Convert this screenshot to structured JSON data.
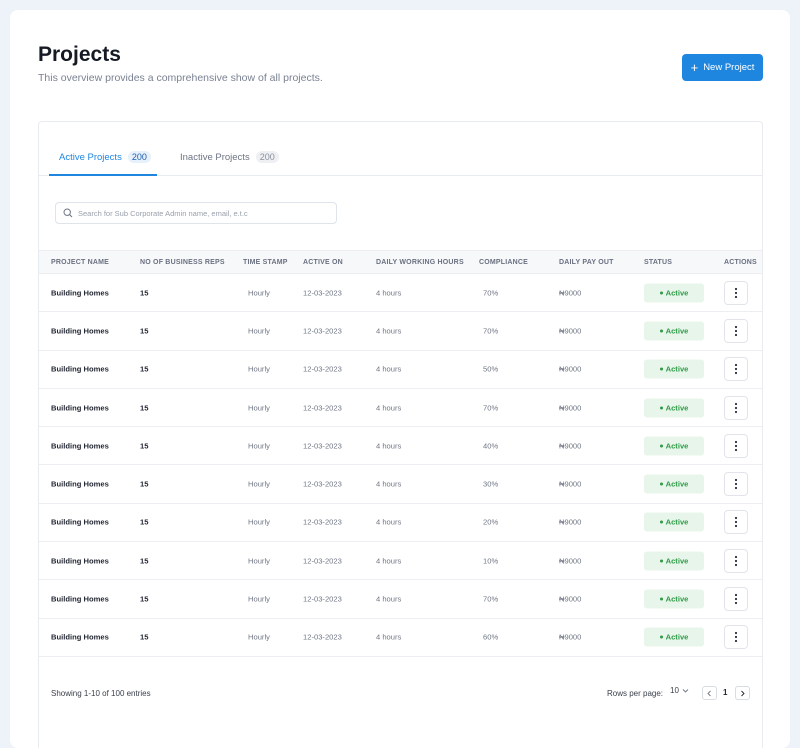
{
  "header": {
    "title": "Projects",
    "subtitle": "This overview provides a comprehensive show of all projects.",
    "new_button_label": "New Project",
    "new_button_icon": "plus-icon"
  },
  "tabs": [
    {
      "label": "Active Projects",
      "count": "200",
      "active": true
    },
    {
      "label": "Inactive Projects",
      "count": "200",
      "active": false
    }
  ],
  "search": {
    "placeholder": "Search for Sub Corporate Admin name, email, e.t.c",
    "value": "",
    "icon": "search-icon"
  },
  "table": {
    "columns": [
      "PROJECT NAME",
      "NO OF BUSINESS REPS",
      "TIME STAMP",
      "ACTIVE ON",
      "DAILY WORKING HOURS",
      "COMPLIANCE",
      "DAILY PAY OUT",
      "STATUS",
      "ACTIONS"
    ],
    "rows": [
      {
        "name": "Building Homes",
        "reps": "15",
        "timestamp": "Hourly",
        "active_on": "12-03-2023",
        "hours": "4 hours",
        "compliance": "70%",
        "payout": "₦9000",
        "status": "Active"
      },
      {
        "name": "Building Homes",
        "reps": "15",
        "timestamp": "Hourly",
        "active_on": "12-03-2023",
        "hours": "4 hours",
        "compliance": "70%",
        "payout": "₦9000",
        "status": "Active"
      },
      {
        "name": "Building Homes",
        "reps": "15",
        "timestamp": "Hourly",
        "active_on": "12-03-2023",
        "hours": "4 hours",
        "compliance": "50%",
        "payout": "₦9000",
        "status": "Active"
      },
      {
        "name": "Building Homes",
        "reps": "15",
        "timestamp": "Hourly",
        "active_on": "12-03-2023",
        "hours": "4 hours",
        "compliance": "70%",
        "payout": "₦9000",
        "status": "Active"
      },
      {
        "name": "Building Homes",
        "reps": "15",
        "timestamp": "Hourly",
        "active_on": "12-03-2023",
        "hours": "4 hours",
        "compliance": "40%",
        "payout": "₦9000",
        "status": "Active"
      },
      {
        "name": "Building Homes",
        "reps": "15",
        "timestamp": "Hourly",
        "active_on": "12-03-2023",
        "hours": "4 hours",
        "compliance": "30%",
        "payout": "₦9000",
        "status": "Active"
      },
      {
        "name": "Building Homes",
        "reps": "15",
        "timestamp": "Hourly",
        "active_on": "12-03-2023",
        "hours": "4 hours",
        "compliance": "20%",
        "payout": "₦9000",
        "status": "Active"
      },
      {
        "name": "Building Homes",
        "reps": "15",
        "timestamp": "Hourly",
        "active_on": "12-03-2023",
        "hours": "4 hours",
        "compliance": "10%",
        "payout": "₦9000",
        "status": "Active"
      },
      {
        "name": "Building Homes",
        "reps": "15",
        "timestamp": "Hourly",
        "active_on": "12-03-2023",
        "hours": "4 hours",
        "compliance": "70%",
        "payout": "₦9000",
        "status": "Active"
      },
      {
        "name": "Building Homes",
        "reps": "15",
        "timestamp": "Hourly",
        "active_on": "12-03-2023",
        "hours": "4 hours",
        "compliance": "60%",
        "payout": "₦9000",
        "status": "Active"
      }
    ],
    "action_icon": "more-vertical-icon"
  },
  "footer": {
    "entries_text": "Showing 1-10 of 100 entries",
    "rows_per_page_label": "Rows per page:",
    "rows_per_page_value": "10",
    "current_page": "1"
  },
  "colors": {
    "accent": "#1f86e0",
    "status_active_bg": "#e8f5ea",
    "status_active_text": "#2f9a47"
  }
}
